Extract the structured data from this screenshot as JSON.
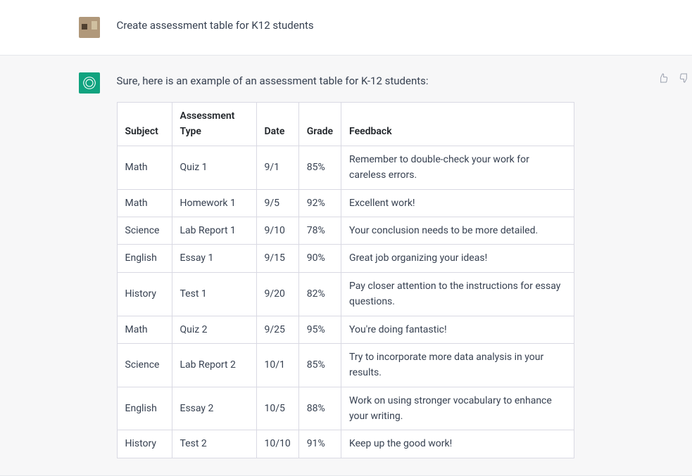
{
  "user_message": {
    "text": "Create assessment table for K12 students"
  },
  "assistant_message": {
    "intro": "Sure, here is an example of an assessment table for K-12 students:",
    "table": {
      "headers": {
        "subject": "Subject",
        "type": "Assessment Type",
        "date": "Date",
        "grade": "Grade",
        "feedback": "Feedback"
      },
      "rows": [
        {
          "subject": "Math",
          "type": "Quiz 1",
          "date": "9/1",
          "grade": "85%",
          "feedback": "Remember to double-check your work for careless errors."
        },
        {
          "subject": "Math",
          "type": "Homework 1",
          "date": "9/5",
          "grade": "92%",
          "feedback": "Excellent work!"
        },
        {
          "subject": "Science",
          "type": "Lab Report 1",
          "date": "9/10",
          "grade": "78%",
          "feedback": "Your conclusion needs to be more detailed."
        },
        {
          "subject": "English",
          "type": "Essay 1",
          "date": "9/15",
          "grade": "90%",
          "feedback": "Great job organizing your ideas!"
        },
        {
          "subject": "History",
          "type": "Test 1",
          "date": "9/20",
          "grade": "82%",
          "feedback": "Pay closer attention to the instructions for essay questions."
        },
        {
          "subject": "Math",
          "type": "Quiz 2",
          "date": "9/25",
          "grade": "95%",
          "feedback": "You're doing fantastic!"
        },
        {
          "subject": "Science",
          "type": "Lab Report 2",
          "date": "10/1",
          "grade": "85%",
          "feedback": "Try to incorporate more data analysis in your results."
        },
        {
          "subject": "English",
          "type": "Essay 2",
          "date": "10/5",
          "grade": "88%",
          "feedback": "Work on using stronger vocabulary to enhance your writing."
        },
        {
          "subject": "History",
          "type": "Test 2",
          "date": "10/10",
          "grade": "91%",
          "feedback": "Keep up the good work!"
        }
      ]
    }
  },
  "icons": {
    "assistant_logo": "openai-logo-icon",
    "thumbs_up": "thumbs-up-icon",
    "thumbs_down": "thumbs-down-icon"
  }
}
